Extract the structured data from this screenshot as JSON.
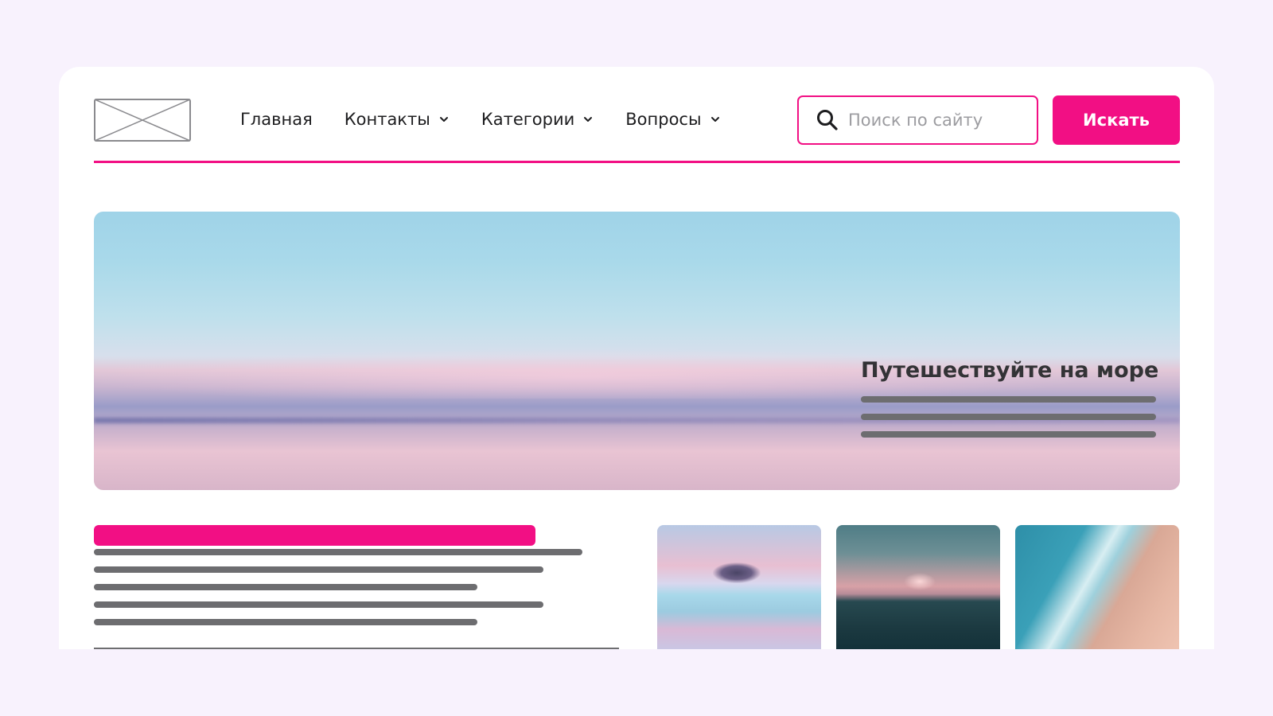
{
  "header": {
    "logo": "logo-placeholder",
    "nav": [
      {
        "label": "Главная",
        "has_dropdown": false
      },
      {
        "label": "Контакты",
        "has_dropdown": true
      },
      {
        "label": "Категории",
        "has_dropdown": true
      },
      {
        "label": "Вопросы",
        "has_dropdown": true
      }
    ],
    "search": {
      "placeholder": "Поиск по сайту",
      "value": ""
    },
    "search_button": "Искать"
  },
  "hero": {
    "title": "Путешествуйте на море",
    "text_lines": 3
  },
  "content": {
    "text_lines": 5
  },
  "gallery": {
    "images": [
      {
        "name": "sea-pink-clouds-image"
      },
      {
        "name": "sea-sunset-waves-image"
      },
      {
        "name": "beach-aerial-image"
      }
    ]
  },
  "colors": {
    "accent": "#f20f84",
    "placeholder_lines": "#6d6d70",
    "background": "#f8f2fd"
  }
}
